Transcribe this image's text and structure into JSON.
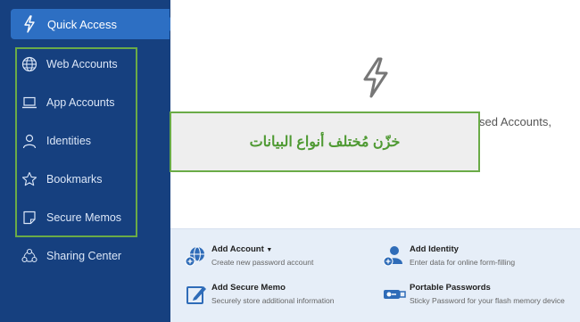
{
  "sidebar": {
    "quick_access": "Quick Access",
    "items": [
      {
        "label": "Web Accounts",
        "icon": "globe-icon"
      },
      {
        "label": "App Accounts",
        "icon": "laptop-icon"
      },
      {
        "label": "Identities",
        "icon": "person-icon"
      },
      {
        "label": "Bookmarks",
        "icon": "star-icon"
      },
      {
        "label": "Secure Memos",
        "icon": "memo-icon"
      },
      {
        "label": "Sharing Center",
        "icon": "share-icon"
      }
    ]
  },
  "main": {
    "partial_text": "sed Accounts,"
  },
  "callout": {
    "text": "خزّن مُختلف أنواع البيانات"
  },
  "actions": [
    {
      "title": "Add Account",
      "desc": "Create new password account",
      "icon": "add-account-icon"
    },
    {
      "title": "Add Identity",
      "desc": "Enter data for online form-filling",
      "icon": "add-identity-icon"
    },
    {
      "title": "Add Secure Memo",
      "desc": "Securely store additional information",
      "icon": "add-memo-icon"
    },
    {
      "title": "Portable Passwords",
      "desc": "Sticky Password for your flash memory device",
      "icon": "usb-icon"
    }
  ],
  "colors": {
    "sidebar": "#16407f",
    "active": "#2d6fc3",
    "highlight_green": "#6aab47",
    "bottom_panel": "#e6eef8"
  }
}
